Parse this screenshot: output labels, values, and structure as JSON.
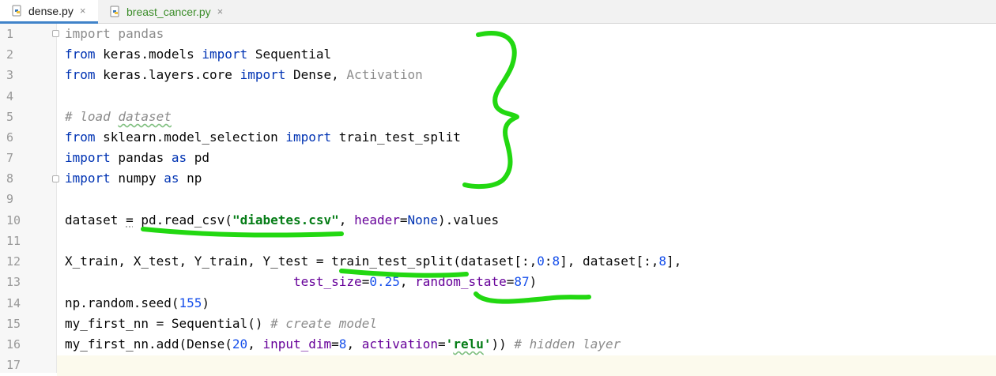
{
  "tabs": [
    {
      "label": "dense.py",
      "close": "×"
    },
    {
      "label": "breast_cancer.py",
      "close": "×"
    }
  ],
  "line_numbers": [
    "1",
    "2",
    "3",
    "4",
    "5",
    "6",
    "7",
    "8",
    "9",
    "10",
    "11",
    "12",
    "13",
    "14",
    "15",
    "16",
    "17"
  ],
  "code": {
    "l1": {
      "kw": "import",
      "rest": " pandas"
    },
    "l2": {
      "kw1": "from",
      "mod": " keras.models ",
      "kw2": "import",
      "rest": " Sequential"
    },
    "l3": {
      "kw1": "from",
      "mod": " keras.layers.core ",
      "kw2": "import",
      "name": " Dense, ",
      "unused": "Activation"
    },
    "l5": {
      "comment_a": "# load ",
      "comment_b": "dataset"
    },
    "l6": {
      "kw1": "from",
      "mod": " sklearn.model_selection ",
      "kw2": "import",
      "rest": " train_test_split"
    },
    "l7": {
      "kw1": "import",
      "mid": " pandas ",
      "kw2": "as",
      "rest": " pd"
    },
    "l8": {
      "kw1": "import",
      "mid": " numpy ",
      "kw2": "as",
      "rest": " np"
    },
    "l10": {
      "a": "dataset ",
      "b": "=",
      "c": " pd.read_csv(",
      "str": "\"diabetes.csv\"",
      "d": ", ",
      "param": "header",
      "e": "=",
      "kw": "None",
      "f": ").values"
    },
    "l12": {
      "a": "X_train, X_test, Y_train, Y_test = train_test_split(dataset[:,",
      "n1": "0",
      "b": ":",
      "n2": "8",
      "c": "], dataset[:,",
      "n3": "8",
      "d": "],"
    },
    "l13": {
      "indent": "                              ",
      "p1": "test_size",
      "eq1": "=",
      "n1": "0.25",
      "sep": ", ",
      "p2": "random_state",
      "eq2": "=",
      "n2": "87",
      "end": ")"
    },
    "l14": {
      "a": "np.random.seed(",
      "n": "155",
      "b": ")"
    },
    "l15": {
      "a": "my_first_nn = Sequential() ",
      "cmt": "# create model"
    },
    "l16": {
      "a": "my_first_nn.add(Dense(",
      "n1": "20",
      "b": ", ",
      "p1": "input_dim",
      "eq1": "=",
      "n2": "8",
      "c": ", ",
      "p2": "activation",
      "eq2": "=",
      "s1": "'",
      "s2": "relu",
      "s3": "'",
      "d": ")) ",
      "cmt": "# hidden layer"
    }
  },
  "colors": {
    "annotation": "#22d811",
    "keyword": "#0033b3",
    "string": "#067d17",
    "number": "#1750eb",
    "parameter": "#660099",
    "comment": "#8c8c8c",
    "tab_underline": "#4083c9"
  },
  "icons": {
    "tab_file": "python-file-icon",
    "tab_close": "close-icon",
    "fold": "fold-marker-icon"
  }
}
